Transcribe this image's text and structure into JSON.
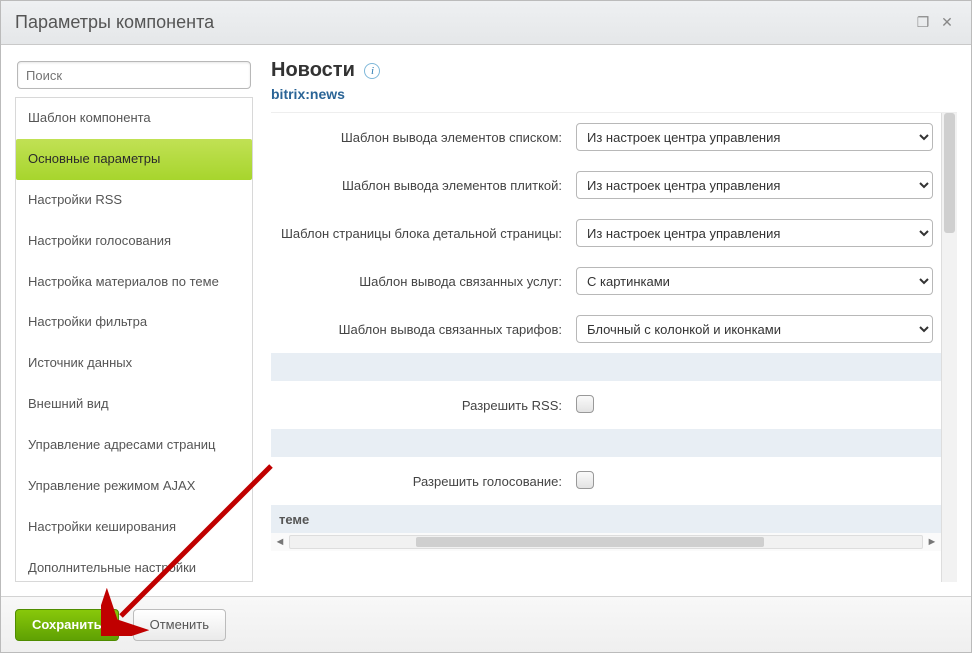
{
  "window_title": "Параметры компонента",
  "search_placeholder": "Поиск",
  "sidebar": {
    "items": [
      {
        "label": "Шаблон компонента"
      },
      {
        "label": "Основные параметры",
        "active": true
      },
      {
        "label": "Настройки RSS"
      },
      {
        "label": "Настройки голосования"
      },
      {
        "label": "Настройка материалов по теме"
      },
      {
        "label": "Настройки фильтра"
      },
      {
        "label": "Источник данных"
      },
      {
        "label": "Внешний вид"
      },
      {
        "label": "Управление адресами страниц"
      },
      {
        "label": "Управление режимом AJAX"
      },
      {
        "label": "Настройки кеширования"
      },
      {
        "label": "Дополнительные настройки"
      }
    ]
  },
  "header": {
    "title": "Новости",
    "code": "bitrix:news"
  },
  "params": [
    {
      "label": "Шаблон вывода элементов списком:",
      "value": "Из настроек центра управления",
      "type": "select"
    },
    {
      "label": "Шаблон вывода элементов плиткой:",
      "value": "Из настроек центра управления",
      "type": "select"
    },
    {
      "label": "Шаблон страницы блока детальной страницы:",
      "value": "Из настроек центра управления",
      "type": "select"
    },
    {
      "label": "Шаблон вывода связанных услуг:",
      "value": "С картинками",
      "type": "select"
    },
    {
      "label": "Шаблон вывода связанных тарифов:",
      "value": "Блочный с колонкой и иконками",
      "type": "select"
    }
  ],
  "params2": [
    {
      "label": "Разрешить RSS:",
      "type": "checkbox"
    }
  ],
  "params3": [
    {
      "label": "Разрешить голосование:",
      "type": "checkbox"
    }
  ],
  "section_partial": "теме",
  "footer": {
    "save": "Сохранить",
    "cancel": "Отменить"
  }
}
